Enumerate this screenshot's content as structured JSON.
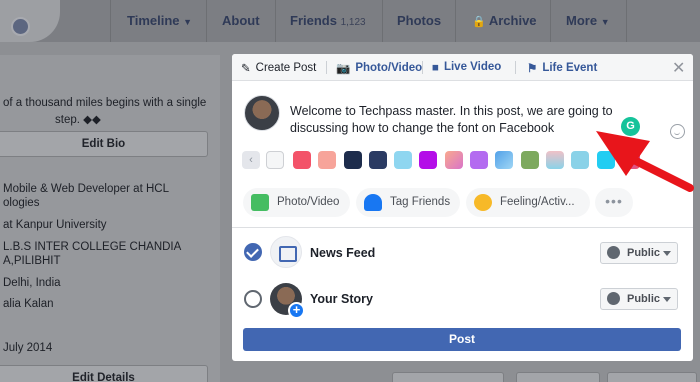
{
  "nav": {
    "timeline": "Timeline",
    "about": "About",
    "friends": "Friends",
    "friends_count": "1,123",
    "photos": "Photos",
    "archive": "Archive",
    "more": "More"
  },
  "intro": {
    "bio": "of a thousand miles begins with a single",
    "bio_2": "step. ◆◆",
    "edit_bio": "Edit Bio",
    "items": [
      "Mobile & Web Developer at HCL",
      "ologies",
      "at Kanpur University",
      "L.B.S INTER COLLEGE CHANDIA",
      "A,PILIBHIT",
      "Delhi, India",
      "alia Kalan",
      "July 2014"
    ],
    "edit_details": "Edit Details"
  },
  "modal": {
    "tabs": [
      "Create Post",
      "Photo/Video",
      "Live Video",
      "Life Event"
    ],
    "composer_text": "Welcome to Techpass master. In this post, we are going to discussing how to change the font on Facebook",
    "grammarly_letter": "G",
    "swatch_colors": [
      "#f5f6f7",
      "#f35369",
      "#f7a49a",
      "#1d2c4c",
      "#1d2c4c",
      "#8fd6f0",
      "#b40ee8",
      "#f9a98e",
      "#d18ff5",
      "#52a1e8",
      "#7da95e",
      "#f0c1c7",
      "#8ad2e8",
      "#22cdf2",
      "#9a5cf0"
    ],
    "actions": [
      "Photo/Video",
      "Tag Friends",
      "Feeling/Activ..."
    ],
    "more": "•••",
    "destinations": [
      {
        "label": "News Feed",
        "privacy": "Public",
        "selected": true
      },
      {
        "label": "Your Story",
        "privacy": "Public",
        "selected": false
      }
    ],
    "post_button": "Post"
  },
  "colors": {
    "accent": "#4267b2",
    "annotation_arrow": "#e8151b"
  }
}
